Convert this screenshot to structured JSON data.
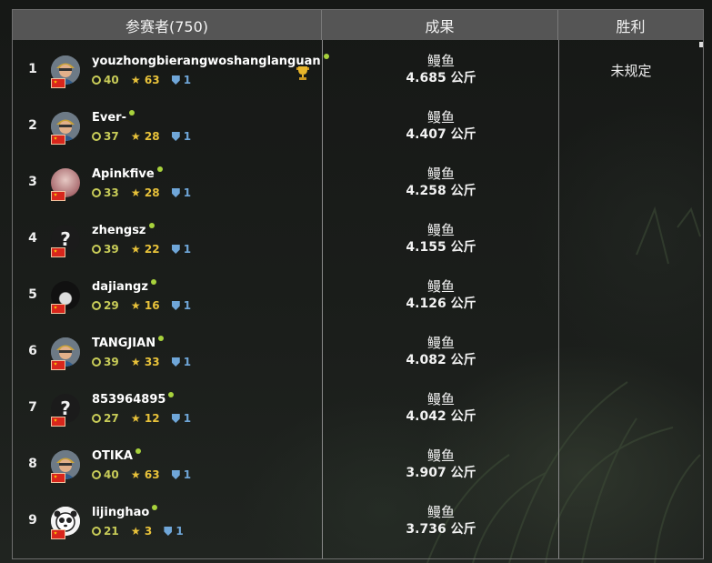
{
  "header": {
    "participants": "参赛者(750)",
    "result": "成果",
    "victory": "胜利"
  },
  "rows": [
    {
      "rank": "1",
      "name": "youzhongbierangwoshanglanguan",
      "level": "40",
      "stars": "63",
      "shield": "1",
      "fish": "鳗鱼",
      "weight": "4.685 公斤",
      "prize": "未规定",
      "avatar": "miner",
      "trophy": true
    },
    {
      "rank": "2",
      "name": "Ever-",
      "level": "37",
      "stars": "28",
      "shield": "1",
      "fish": "鳗鱼",
      "weight": "4.407 公斤",
      "prize": "",
      "avatar": "miner"
    },
    {
      "rank": "3",
      "name": "Apinkfive",
      "level": "33",
      "stars": "28",
      "shield": "1",
      "fish": "鳗鱼",
      "weight": "4.258 公斤",
      "prize": "",
      "avatar": "pink"
    },
    {
      "rank": "4",
      "name": "zhengsz",
      "level": "39",
      "stars": "22",
      "shield": "1",
      "fish": "鳗鱼",
      "weight": "4.155 公斤",
      "prize": "",
      "avatar": "unknown"
    },
    {
      "rank": "5",
      "name": "dajiangz",
      "level": "29",
      "stars": "16",
      "shield": "1",
      "fish": "鳗鱼",
      "weight": "4.126 公斤",
      "prize": "",
      "avatar": "dark"
    },
    {
      "rank": "6",
      "name": "TANGJIAN",
      "level": "39",
      "stars": "33",
      "shield": "1",
      "fish": "鳗鱼",
      "weight": "4.082 公斤",
      "prize": "",
      "avatar": "miner"
    },
    {
      "rank": "7",
      "name": "853964895",
      "level": "27",
      "stars": "12",
      "shield": "1",
      "fish": "鳗鱼",
      "weight": "4.042 公斤",
      "prize": "",
      "avatar": "unknown"
    },
    {
      "rank": "8",
      "name": "OTIKA",
      "level": "40",
      "stars": "63",
      "shield": "1",
      "fish": "鳗鱼",
      "weight": "3.907 公斤",
      "prize": "",
      "avatar": "miner"
    },
    {
      "rank": "9",
      "name": "lijinghao",
      "level": "21",
      "stars": "3",
      "shield": "1",
      "fish": "鳗鱼",
      "weight": "3.736 公斤",
      "prize": "",
      "avatar": "panda"
    }
  ],
  "colors": {
    "online": "#a8d23c",
    "level": "#c8cc58",
    "star": "#e8c23a",
    "shield": "#6fa6d8",
    "header_bg": "#555555"
  },
  "icons": {
    "level": "ring-icon",
    "stars": "star-icon",
    "shield": "shield-icon",
    "winner": "trophy-icon",
    "country": "china-flag-icon"
  }
}
